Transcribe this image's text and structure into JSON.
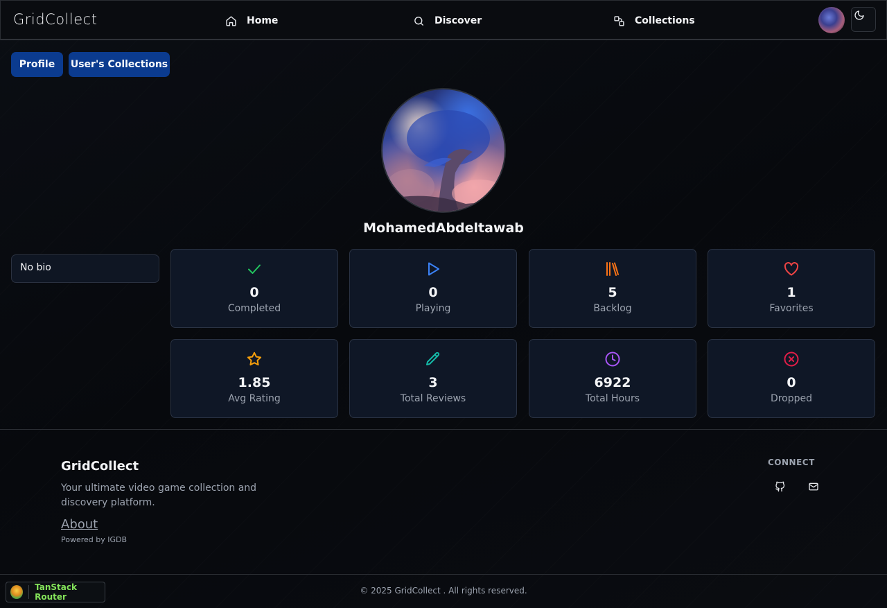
{
  "brand": "GridCollect",
  "nav": {
    "links": [
      {
        "label": "Home",
        "icon": "home-icon"
      },
      {
        "label": "Discover",
        "icon": "search-icon"
      },
      {
        "label": "Collections",
        "icon": "collections-icon"
      }
    ],
    "theme_icon": "moon-icon"
  },
  "tabs": [
    "Profile",
    "User's Collections"
  ],
  "profile": {
    "username": "MohamedAbdeltawab",
    "bio": "No bio"
  },
  "stats": [
    {
      "value": "0",
      "label": "Completed",
      "icon": "check-icon",
      "color": "#22c55e"
    },
    {
      "value": "0",
      "label": "Playing",
      "icon": "play-icon",
      "color": "#3b82f6"
    },
    {
      "value": "5",
      "label": "Backlog",
      "icon": "library-icon",
      "color": "#f97316"
    },
    {
      "value": "1",
      "label": "Favorites",
      "icon": "heart-icon",
      "color": "#ef4444"
    },
    {
      "value": "1.85",
      "label": "Avg Rating",
      "icon": "star-icon",
      "color": "#f59e0b"
    },
    {
      "value": "3",
      "label": "Total Reviews",
      "icon": "pencil-icon",
      "color": "#14b8a6"
    },
    {
      "value": "6922",
      "label": "Total Hours",
      "icon": "clock-icon",
      "color": "#a855f7"
    },
    {
      "value": "0",
      "label": "Dropped",
      "icon": "x-circle-icon",
      "color": "#e11d48"
    }
  ],
  "footer": {
    "title": "GridCollect",
    "description": "Your ultimate video game collection and discovery platform.",
    "about": "About",
    "powered": "Powered by IGDB",
    "connect": "CONNECT",
    "copyright": "© 2025 GridCollect . All rights reserved."
  },
  "devtools": {
    "label": "TanStack Router"
  }
}
